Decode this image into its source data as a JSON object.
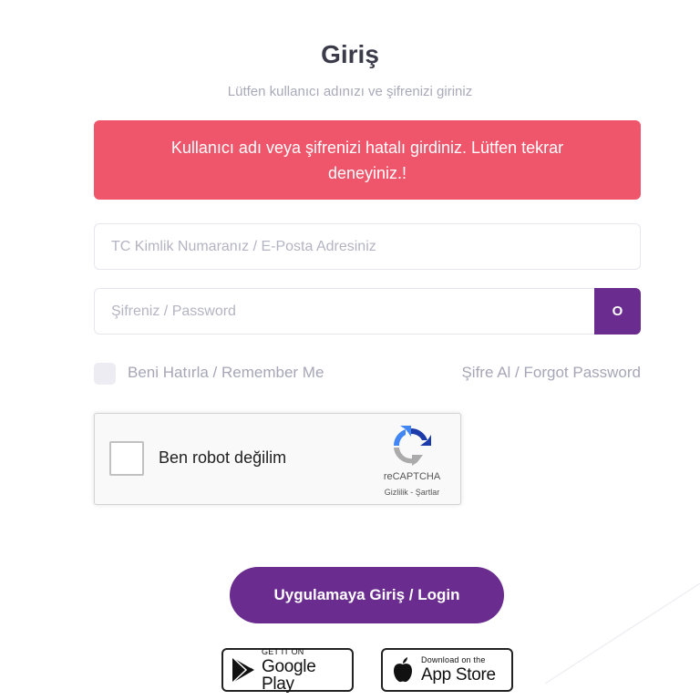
{
  "header": {
    "title": "Giriş",
    "subtitle": "Lütfen kullanıcı adınızı ve şifrenizi giriniz"
  },
  "alert": {
    "message": "Kullanıcı adı veya şifrenizi hatalı girdiniz. Lütfen tekrar deneyiniz.!",
    "color": "#f0566b"
  },
  "form": {
    "username": {
      "placeholder": "TC Kimlik Numaranız / E-Posta Adresiniz",
      "value": ""
    },
    "password": {
      "placeholder": "Şifreniz / Password",
      "value": ""
    },
    "show_password_label": "O",
    "remember_label": "Beni Hatırla / Remember Me",
    "remember_checked": false,
    "forgot_label": "Şifre Al / Forgot Password"
  },
  "recaptcha": {
    "label": "Ben robot değilim",
    "brand": "reCAPTCHA",
    "terms": "Gizlilik - Şartlar",
    "checked": false
  },
  "login_button": {
    "label": "Uygulamaya Giriş / Login",
    "color": "#6a2c8f"
  },
  "stores": {
    "google": {
      "small": "GET IT ON",
      "big": "Google Play",
      "icon": "google-play-icon"
    },
    "apple": {
      "small": "Download on the",
      "big": "App Store",
      "icon": "apple-icon"
    }
  },
  "theme": {
    "accent": "#6a2c8f"
  }
}
